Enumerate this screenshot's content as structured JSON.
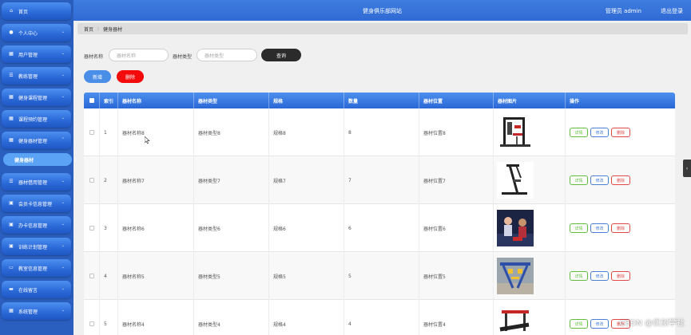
{
  "header": {
    "title": "健身俱乐部网站",
    "user": "管理员 admin",
    "logout": "退出登录"
  },
  "sidebar": {
    "items": [
      {
        "label": "首页",
        "icon": "home-icon",
        "has_chevron": false
      },
      {
        "label": "个人中心",
        "icon": "person-icon",
        "has_chevron": true
      },
      {
        "label": "用户管理",
        "icon": "grid-icon",
        "has_chevron": true
      },
      {
        "label": "教练管理",
        "icon": "sliders-icon",
        "has_chevron": true
      },
      {
        "label": "健身课程管理",
        "icon": "grid-icon",
        "has_chevron": true
      },
      {
        "label": "课程预约管理",
        "icon": "grid-icon",
        "has_chevron": true
      },
      {
        "label": "健身器材管理",
        "icon": "grid-icon",
        "has_chevron": true,
        "expanded": true
      },
      {
        "label": "器材借用管理",
        "icon": "list-icon",
        "has_chevron": true
      },
      {
        "label": "会员卡信息管理",
        "icon": "calendar-icon",
        "has_chevron": true
      },
      {
        "label": "办卡信息管理",
        "icon": "calendar-icon",
        "has_chevron": true
      },
      {
        "label": "训练计划管理",
        "icon": "calendar-icon",
        "has_chevron": true
      },
      {
        "label": "教室信息管理",
        "icon": "screen-icon",
        "has_chevron": true
      },
      {
        "label": "在线留言",
        "icon": "message-icon",
        "has_chevron": true
      },
      {
        "label": "系统管理",
        "icon": "grid-icon",
        "has_chevron": true
      }
    ],
    "active_sub": "健身器材"
  },
  "breadcrumb": {
    "home": "首页",
    "current": "健身器材"
  },
  "search": {
    "name_label": "器材名称",
    "name_placeholder": "器材名称",
    "type_label": "器材类型",
    "type_placeholder": "器材类型",
    "search_button": "查询"
  },
  "actions": {
    "add": "新增",
    "delete": "删除"
  },
  "table": {
    "columns": [
      "索引",
      "器材名称",
      "器材类型",
      "规格",
      "数量",
      "器材位置",
      "器材图片",
      "操作"
    ],
    "row_actions": {
      "detail": "详情",
      "edit": "修改",
      "delete": "删除"
    },
    "rows": [
      {
        "index": "1",
        "name": "器材名称8",
        "type": "器材类型8",
        "spec": "规格8",
        "qty": "8",
        "location": "器材位置8",
        "image": "multi-gym-machine"
      },
      {
        "index": "2",
        "name": "器材名称7",
        "type": "器材类型7",
        "spec": "规格7",
        "qty": "7",
        "location": "器材位置7",
        "image": "ab-crunch-bench"
      },
      {
        "index": "3",
        "name": "器材名称6",
        "type": "器材类型6",
        "spec": "规格6",
        "qty": "6",
        "location": "器材位置6",
        "image": "fitness-photo"
      },
      {
        "index": "4",
        "name": "器材名称5",
        "type": "器材类型5",
        "spec": "规格5",
        "qty": "5",
        "location": "器材位置5",
        "image": "outdoor-equipment"
      },
      {
        "index": "5",
        "name": "器材名称4",
        "type": "器材类型4",
        "spec": "规格4",
        "qty": "4",
        "location": "器材位置4",
        "image": "weight-bench"
      }
    ]
  },
  "watermark": "CSDN @优创学社"
}
